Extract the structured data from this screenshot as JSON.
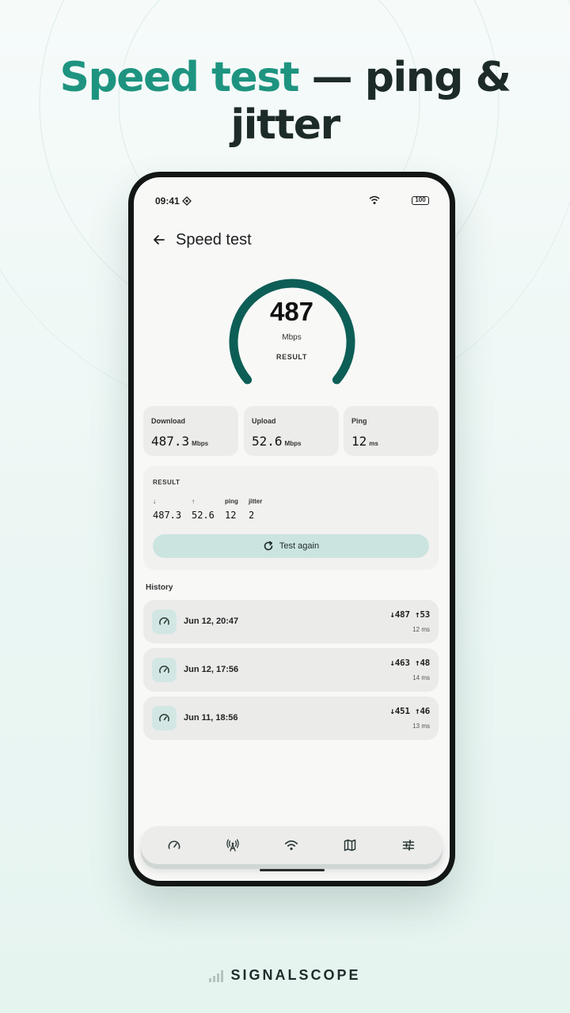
{
  "headline": {
    "accent": "Speed test",
    "rest": " — ping & jitter"
  },
  "status_bar": {
    "time": "09:41",
    "battery": "100"
  },
  "top_bar": {
    "title": "Speed test"
  },
  "gauge": {
    "value": "487",
    "unit": "Mbps",
    "label": "RESULT",
    "fill_fraction": 1.0
  },
  "stats": [
    {
      "label": "Download",
      "value": "487.3",
      "unit": "Mbps"
    },
    {
      "label": "Upload",
      "value": "52.6",
      "unit": "Mbps"
    },
    {
      "label": "Ping",
      "value": "12",
      "unit": "ms"
    }
  ],
  "result": {
    "title": "RESULT",
    "columns": [
      {
        "header": "↓",
        "value": "487.3"
      },
      {
        "header": "↑",
        "value": "52.6"
      },
      {
        "header": "ping",
        "value": "12"
      },
      {
        "header": "jitter",
        "value": "2"
      }
    ],
    "button_label": "Test again"
  },
  "history": {
    "label": "History",
    "items": [
      {
        "date": "Jun 12, 20:47",
        "speeds": "↓487 ↑53",
        "ping": "12 ms"
      },
      {
        "date": "Jun 12, 17:56",
        "speeds": "↓463 ↑48",
        "ping": "14 ms"
      },
      {
        "date": "Jun 11, 18:56",
        "speeds": "↓451 ↑46",
        "ping": "13 ms"
      }
    ]
  },
  "bottom_nav": [
    "speedometer-icon",
    "cell-tower-icon",
    "wifi-icon",
    "map-icon",
    "sliders-icon"
  ],
  "brand": {
    "name": "SIGNALSCOPE"
  },
  "colors": {
    "accent": "#1e9480",
    "gauge": "#0d5e56",
    "button": "#cce4e0"
  }
}
